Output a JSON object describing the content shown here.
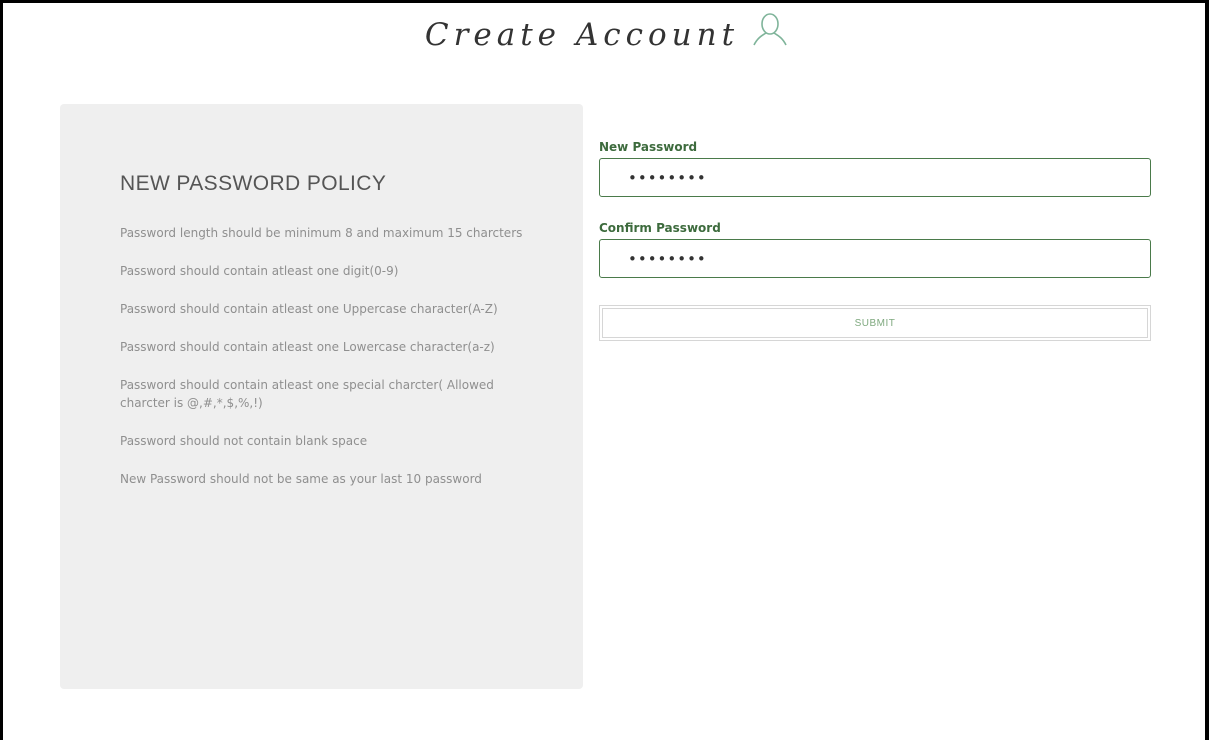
{
  "header": {
    "title": "Create Account",
    "icon": "user-icon",
    "icon_color": "#7fb49a"
  },
  "policy": {
    "title": "NEW PASSWORD POLICY",
    "items": [
      "Password length should be minimum 8 and maximum 15 charcters",
      "Password should contain atleast one digit(0-9)",
      "Password should contain atleast one Uppercase character(A-Z)",
      "Password should contain atleast one Lowercase character(a-z)",
      "Password should contain atleast one special charcter( Allowed charcter is @,#,*,$,%,!)",
      "Password should not contain blank space",
      "New Password should not be same as your last 10 password"
    ]
  },
  "form": {
    "new_password": {
      "label": "New Password",
      "value": "••••••••"
    },
    "confirm_password": {
      "label": "Confirm Password",
      "value": "••••••••"
    },
    "submit_label": "SUBMIT"
  },
  "colors": {
    "accent_green": "#3d6b3d",
    "panel_background": "#efefef",
    "policy_text": "#8f8f8f"
  }
}
